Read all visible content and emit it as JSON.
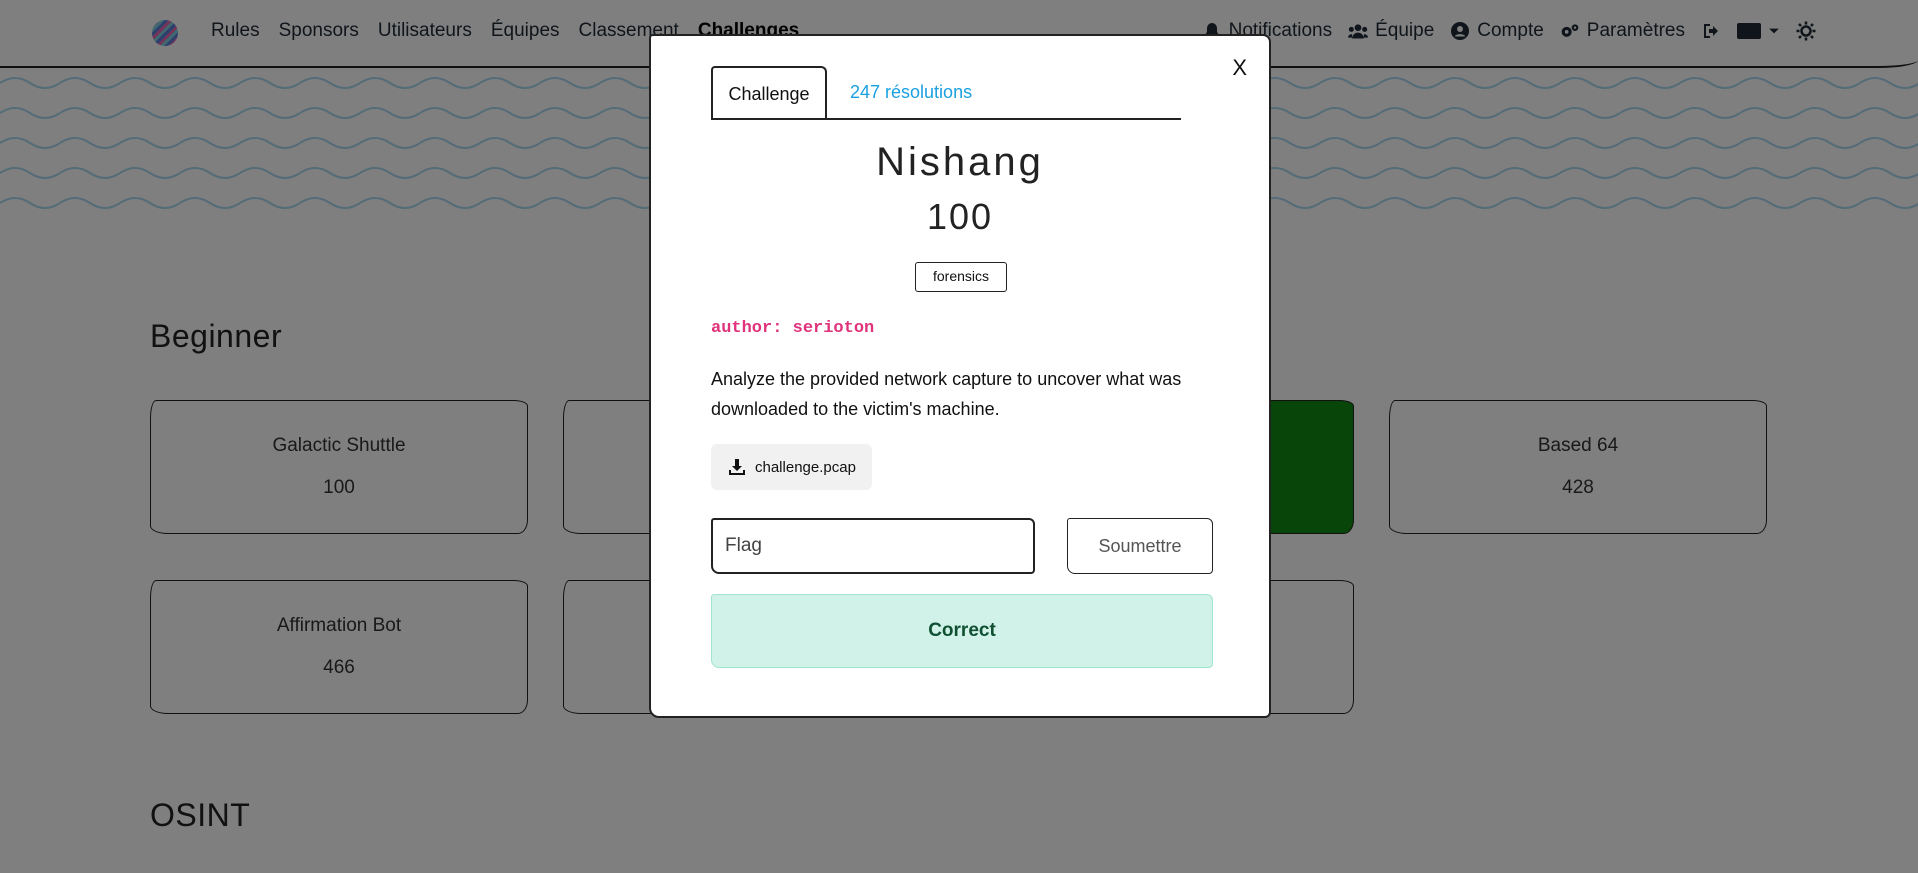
{
  "nav": {
    "left": [
      "Rules",
      "Sponsors",
      "Utilisateurs",
      "Équipes",
      "Classement",
      "Challenges"
    ],
    "notifications": "Notifications",
    "team": "Équipe",
    "account": "Compte",
    "settings": "Paramètres"
  },
  "sections": [
    {
      "title": "Beginner",
      "cards": [
        {
          "name": "Galactic Shuttle",
          "value": "100"
        },
        {
          "name": "",
          "value": ""
        },
        {
          "name": "",
          "value": ""
        },
        {
          "name": "Based 64",
          "value": "428"
        },
        {
          "name": "Affirmation Bot",
          "value": "466"
        },
        {
          "name": "",
          "value": ""
        },
        {
          "name": "",
          "value": ""
        }
      ]
    },
    {
      "title": "OSINT"
    }
  ],
  "modal": {
    "close_label": "X",
    "tab_challenge": "Challenge",
    "tab_solves": "247 résolutions",
    "name": "Nishang",
    "value": "100",
    "tag": "forensics",
    "author": "author: serioton",
    "description": "Analyze the provided network capture to uncover what was downloaded to the victim's machine.",
    "file": "challenge.pcap",
    "flag_placeholder": "Flag",
    "submit_label": "Soumettre",
    "result": "Correct"
  },
  "colors": {
    "solved": "#108b10",
    "result_bg": "#d1f2e8",
    "author": "#e0337c",
    "link": "#1aa0e0"
  }
}
